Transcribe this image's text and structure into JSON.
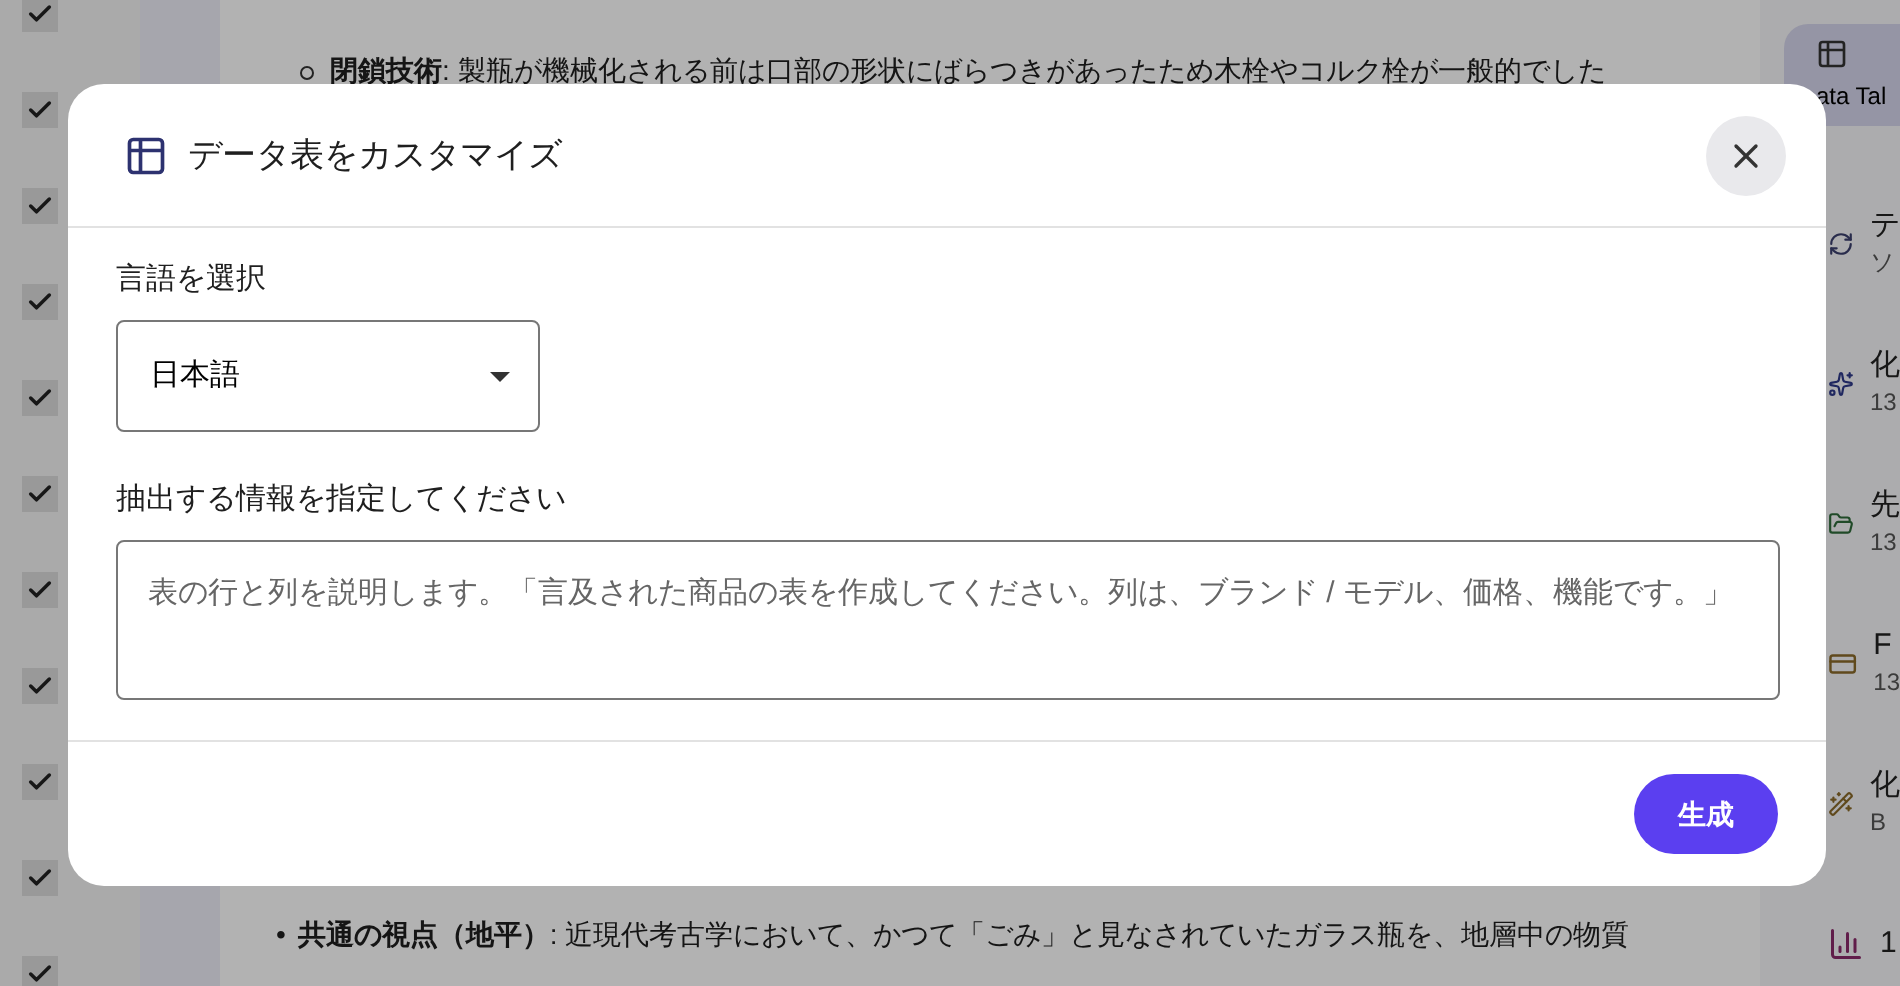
{
  "checkboxes": [
    {
      "checked": true
    },
    {
      "checked": true
    },
    {
      "checked": true
    },
    {
      "checked": true
    },
    {
      "checked": true
    },
    {
      "checked": true
    },
    {
      "checked": true
    },
    {
      "checked": true
    },
    {
      "checked": true
    },
    {
      "checked": true
    },
    {
      "checked": true
    }
  ],
  "article": {
    "bullets": [
      {
        "kind": "circle",
        "lines": [
          "**閉鎖技術**: 製瓶が機械化される前は口部の形状にばらつきがあったため木栓やコルク栓が一般的でした"
        ]
      },
      {
        "kind": "dot",
        "marker": "•",
        "lines": [
          "**共通の視点（地平）**: 近現代考古学において、かつて「ごみ」と見なされていたガラス瓶を、地層中の物質"
        ]
      }
    ]
  },
  "sidebar": {
    "tab": {
      "label": "ata Tal",
      "selected": true
    },
    "items": [
      {
        "kind": "refresh",
        "title": "テ",
        "subtitle": "ソ"
      },
      {
        "kind": "sparkle",
        "title": "化",
        "subtitle": "13"
      },
      {
        "kind": "share",
        "title": "先",
        "subtitle": "13"
      },
      {
        "kind": "card",
        "title": "F",
        "subtitle": "13"
      },
      {
        "kind": "sparkle2",
        "title": "化",
        "subtitle": "B"
      },
      {
        "kind": "chart",
        "title": "1"
      }
    ]
  },
  "dialog": {
    "title": "データ表をカスタマイズ",
    "language_label": "言語を選択",
    "language_value": "日本語",
    "prompt_label": "抽出する情報を指定してください",
    "prompt_placeholder": "表の行と列を説明します。「言及された商品の表を作成してください。列は、ブランド / モデル、価格、機能です。」",
    "generate_button": "生成"
  }
}
